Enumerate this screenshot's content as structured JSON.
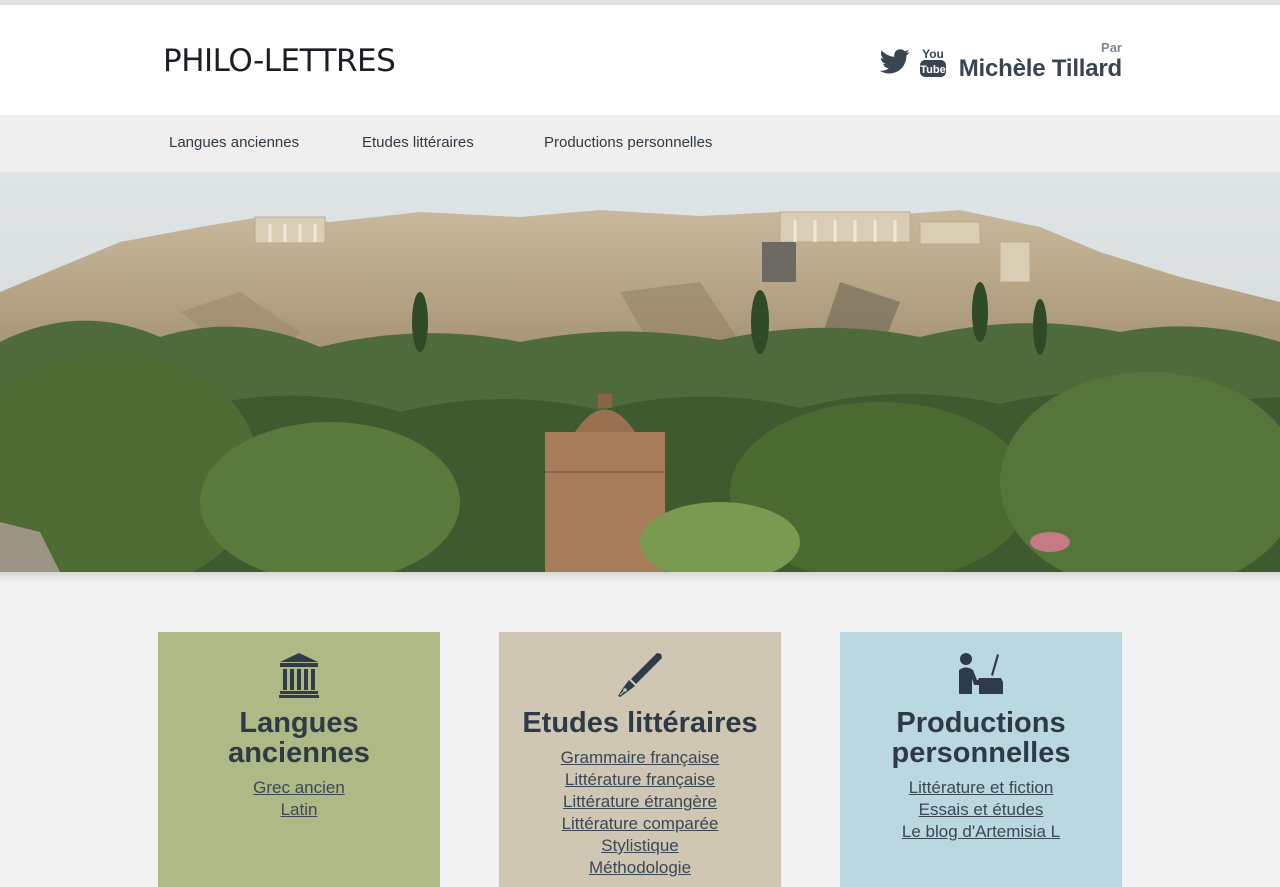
{
  "site": {
    "title": "PHILO-LETTRES",
    "author_prefix": "Par",
    "author_name": "Michèle Tillard"
  },
  "social": [
    {
      "icon": "twitter-icon"
    },
    {
      "icon": "youtube-icon"
    }
  ],
  "nav": {
    "items": [
      {
        "label": "Langues anciennes"
      },
      {
        "label": "Etudes littéraires"
      },
      {
        "label": "Productions personnelles"
      }
    ]
  },
  "hero": {
    "image": "acropolis-landscape-photo"
  },
  "colors": {
    "card_ancient": "#aeba85",
    "card_literary": "#cfc7b3",
    "card_personal": "#b9d8e0",
    "text_dark": "#2e3a47"
  },
  "cards": [
    {
      "icon": "temple-icon",
      "title": "Langues anciennes",
      "links": [
        "Grec ancien",
        "Latin"
      ]
    },
    {
      "icon": "fountain-pen-icon",
      "title": "Etudes littéraires",
      "links": [
        "Grammaire française",
        "Littérature française",
        "Littérature étrangère",
        "Littérature comparée",
        "Stylistique",
        "Méthodologie"
      ]
    },
    {
      "icon": "person-writing-icon",
      "title": "Productions personnelles",
      "links": [
        "Littérature et fiction",
        "Essais et études",
        "Le blog d'Artemisia L"
      ]
    }
  ]
}
